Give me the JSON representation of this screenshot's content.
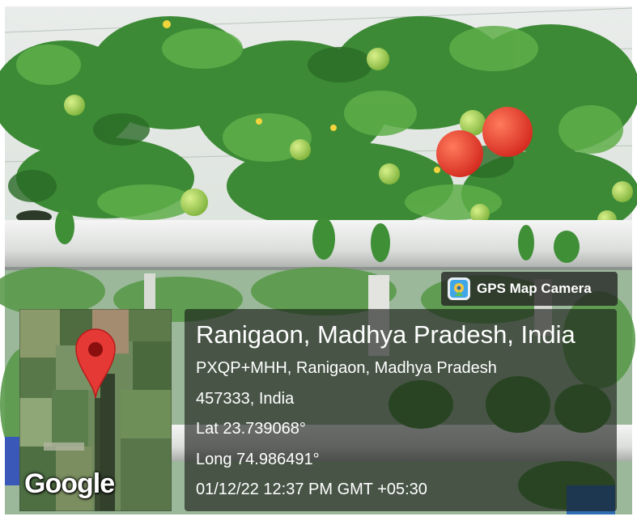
{
  "badge": {
    "label": "GPS Map Camera",
    "icon": "gps-map-camera-icon"
  },
  "map": {
    "provider": "Google",
    "marker_icon": "location-pin-icon"
  },
  "location": {
    "title": "Ranigaon, Madhya Pradesh, India",
    "address_line1": "PXQP+MHH, Ranigaon, Madhya Pradesh",
    "address_line2": "457333, India",
    "lat": "Lat 23.739068°",
    "long": "Long 74.986491°",
    "datetime": "01/12/22 12:37 PM GMT +05:30"
  },
  "colors": {
    "pin": "#e53935",
    "panel": "#141614",
    "foliage": "#3c8a35",
    "tomato_ripe": "#e5372a"
  }
}
